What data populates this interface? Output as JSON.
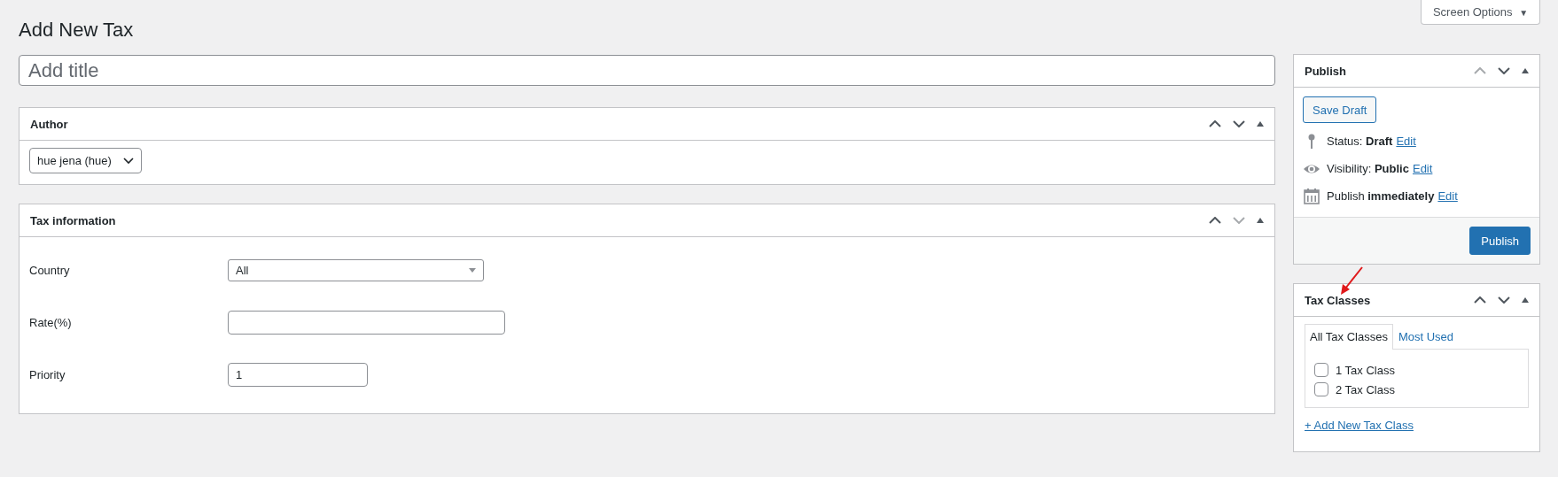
{
  "screen_options": {
    "label": "Screen Options",
    "caret": "▼"
  },
  "heading": "Add New Tax",
  "title_field": {
    "placeholder": "Add title"
  },
  "author_box": {
    "title": "Author",
    "move_up_disabled": false,
    "move_down_disabled": false,
    "author": "hue jena (hue)"
  },
  "tax_info_box": {
    "title": "Tax information",
    "move_up_disabled": false,
    "move_down_disabled": true,
    "fields": [
      {
        "label": "Country",
        "kind": "select",
        "value": "All"
      },
      {
        "label": "Rate(%)",
        "kind": "text"
      },
      {
        "label": "Priority",
        "kind": "number",
        "value": "1"
      }
    ]
  },
  "publish_box": {
    "title": "Publish",
    "move_up_disabled": true,
    "move_down_disabled": false,
    "save_draft": "Save Draft",
    "rows": [
      {
        "kind": "status",
        "label": "Status:",
        "value": "Draft",
        "link": "Edit"
      },
      {
        "kind": "visibility",
        "label": "Visibility:",
        "value": "Public",
        "link": "Edit"
      },
      {
        "kind": "schedule",
        "label": "Publish",
        "value": "immediately",
        "link": "Edit"
      }
    ],
    "publish_button": "Publish"
  },
  "tax_classes_box": {
    "title": "Tax Classes",
    "move_up_disabled": false,
    "move_down_disabled": false,
    "tabs": [
      {
        "label": "All Tax Classes",
        "selected": true
      },
      {
        "label": "Most Used",
        "selected": false
      }
    ],
    "items": [
      {
        "label": "1 Tax Class",
        "checked": false
      },
      {
        "label": "2 Tax Class",
        "checked": false
      }
    ],
    "add_link": "+ Add New Tax Class"
  }
}
